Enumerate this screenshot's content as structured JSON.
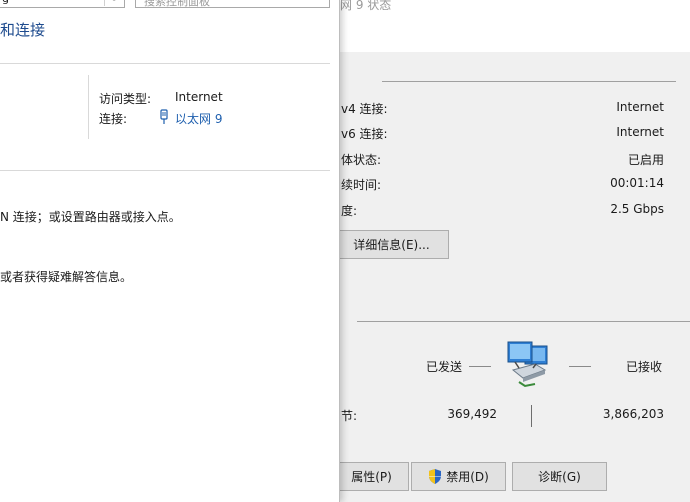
{
  "status_window": {
    "title": "网 9 状态",
    "rows": [
      {
        "label": "v4 连接:",
        "value": "Internet"
      },
      {
        "label": "v6 连接:",
        "value": "Internet"
      },
      {
        "label": "体状态:",
        "value": "已启用"
      },
      {
        "label": "续时间:",
        "value": "00:01:14"
      },
      {
        "label": "度:",
        "value": "2.5 Gbps"
      }
    ],
    "details_button": "详细信息(E)...",
    "activity": {
      "sent_label": "已发送",
      "received_label": "已接收",
      "bytes_label": "节:",
      "sent_value": "369,492",
      "received_value": "3,866,203"
    },
    "buttons": {
      "properties": "属性(P)",
      "disable": "禁用(D)",
      "diagnose": "诊断(G)"
    }
  },
  "nsc_window": {
    "address_text": "g",
    "search_placeholder": "搜索控制面板",
    "heading": "和连接",
    "access_type_label": "访问类型:",
    "access_type_value": "Internet",
    "connections_label": "连接:",
    "connection_name": "以太网 9",
    "task1": "N 连接；或设置路由器或接入点。",
    "task2": "或者获得疑难解答信息。"
  },
  "colors": {
    "link": "#1e5fae",
    "window_bg": "#f0f0f0",
    "button_bg": "#e1e1e1"
  }
}
